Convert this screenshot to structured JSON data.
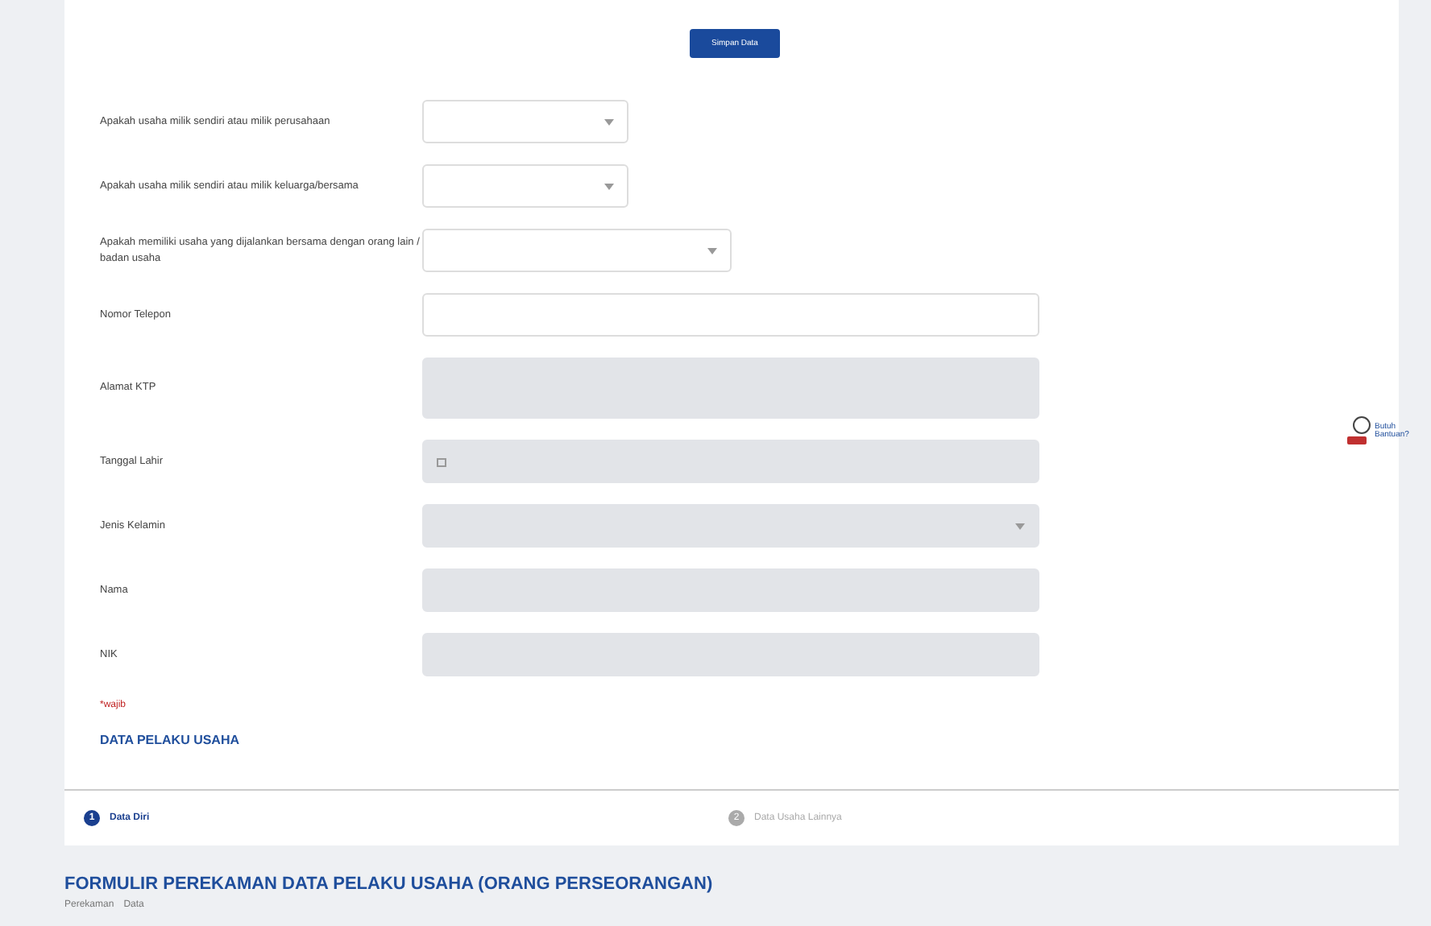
{
  "save_button": "Simpan Data",
  "fields": [
    {
      "kind": "question",
      "label": "Apakah usaha milik sendiri atau milik perusahaan",
      "disabled": false
    },
    {
      "kind": "question",
      "label": "Apakah usaha milik sendiri atau milik keluarga/bersama",
      "disabled": false
    },
    {
      "kind": "question",
      "label": "Apakah memiliki usaha yang dijalankan bersama dengan orang lain / badan usaha",
      "disabled": false
    },
    {
      "kind": "text",
      "label": "Nomor Telepon",
      "disabled": false
    },
    {
      "kind": "textarea",
      "label": "Alamat KTP",
      "disabled": true
    },
    {
      "kind": "date",
      "label": "Tanggal Lahir",
      "disabled": true
    },
    {
      "kind": "select",
      "label": "Jenis Kelamin",
      "disabled": true
    },
    {
      "kind": "text",
      "label": "Nama",
      "disabled": true
    },
    {
      "kind": "text",
      "label": "NIK",
      "disabled": true
    }
  ],
  "section": {
    "required_note": "*wajib",
    "heading": "DATA PELAKU USAHA"
  },
  "steps": [
    {
      "number": "1",
      "label": "Data Diri",
      "selected": true
    },
    {
      "number": "2",
      "label": "Data Usaha Lainnya",
      "selected": false
    }
  ],
  "title": "FORMULIR PEREKAMAN DATA PELAKU USAHA (ORANG PERSEORANGAN)",
  "breadcrumb": [
    "Perekaman",
    "Data"
  ],
  "help_widget": {
    "label": "Butuh Bantuan?"
  }
}
